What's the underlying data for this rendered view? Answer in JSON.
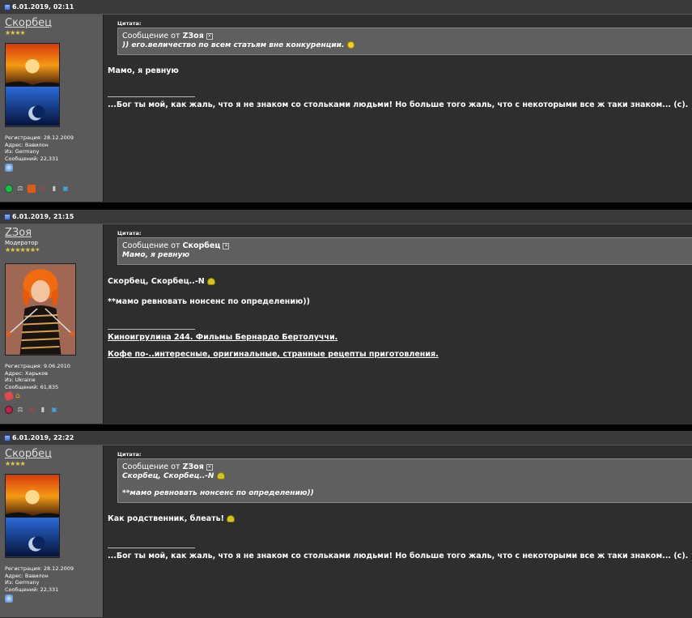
{
  "posts": [
    {
      "date": "6.01.2019, 02:11",
      "username": "Скорбец",
      "title": "",
      "stars": "★★★★",
      "reg": "Регистрация: 28.12.2009",
      "addr": "Адрес: Вавилон",
      "from": "Из: Germany",
      "count": "Сообщений: 22,331",
      "quote_label": "Цитата:",
      "quote_head": "Сообщение от",
      "quote_author": "ZЗоя",
      "quote_lines": [
        ")) его.величество по всем статьям вне конкуренции."
      ],
      "message": "Мамо, я ревную",
      "sig": "...Бог ты мой, как жаль, что я не знаком со стольками людьми! Но больше того жаль, что с некоторыми все ж таки знаком... (с)."
    },
    {
      "date": "6.01.2019, 21:15",
      "username": "ZЗоя",
      "title": "Модератор",
      "stars": "★★★★★★✶",
      "reg": "Регистрация: 9.06.2010",
      "addr": "Адрес: Харьков",
      "from": "Из: Ukraine",
      "count": "Сообщений: 61,835",
      "quote_label": "Цитата:",
      "quote_head": "Сообщение от",
      "quote_author": "Скорбец",
      "quote_lines": [
        "Мамо, я ревную"
      ],
      "message": "Скорбец, Скорбец..-N",
      "message2": "**мамо ревновать нонсенс по определению))",
      "link1": "Киноигрулина 244. Фильмы Бернардо Бертолуччи.",
      "link2": "Кофе по-..интересные, оригинальные, странные рецепты приготовления."
    },
    {
      "date": "6.01.2019, 22:22",
      "username": "Скорбец",
      "title": "",
      "stars": "★★★★",
      "reg": "Регистрация: 28.12.2009",
      "addr": "Адрес: Вавилон",
      "from": "Из: Germany",
      "count": "Сообщений: 22,331",
      "quote_label": "Цитата:",
      "quote_head": "Сообщение от",
      "quote_author": "ZЗоя",
      "quote_lines": [
        "Скорбец, Скорбец..-N",
        "**мамо ревновать нонсенс по определению))"
      ],
      "message": "Как родственник, блеать!",
      "sig": "...Бог ты мой, как жаль, что я не знаком со стольками людьми! Но больше того жаль, что с некоторыми все ж таки знаком... (с)."
    }
  ],
  "icons": {
    "quote_image": "quote-image-icon",
    "smile": "smile-icon",
    "grin": "grin-icon"
  },
  "colors": {
    "background": "#2e2e2e",
    "sidebar": "#5a5a5a",
    "quote_bg": "#5f5f5f",
    "star": "#e8c94a"
  }
}
